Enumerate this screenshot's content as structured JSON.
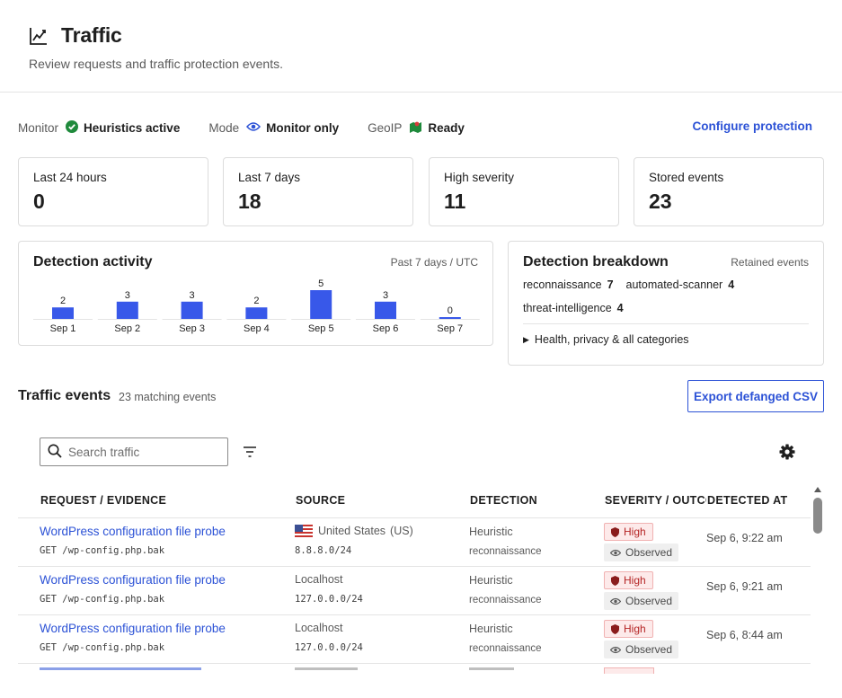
{
  "header": {
    "icon": "chart-line-icon",
    "title": "Traffic",
    "subtitle": "Review requests and traffic protection events."
  },
  "status": {
    "monitor_label": "Monitor",
    "monitor_value": "Heuristics active",
    "mode_label": "Mode",
    "mode_value": "Monitor only",
    "geoip_label": "GeoIP",
    "geoip_value": "Ready",
    "configure_link": "Configure protection"
  },
  "stats": [
    {
      "label": "Last 24 hours",
      "value": "0"
    },
    {
      "label": "Last 7 days",
      "value": "18"
    },
    {
      "label": "High severity",
      "value": "11"
    },
    {
      "label": "Stored events",
      "value": "23"
    }
  ],
  "activity": {
    "title": "Detection activity",
    "meta": "Past 7 days / UTC"
  },
  "chart_data": {
    "type": "bar",
    "categories": [
      "Sep 1",
      "Sep 2",
      "Sep 3",
      "Sep 4",
      "Sep 5",
      "Sep 6",
      "Sep 7"
    ],
    "values": [
      2,
      3,
      3,
      2,
      5,
      3,
      0
    ],
    "title": "Detection activity",
    "subtitle": "Past 7 days / UTC",
    "bar_color": "#3858e9",
    "grid": false
  },
  "breakdown": {
    "title": "Detection breakdown",
    "meta": "Retained events",
    "items": [
      {
        "label": "reconnaissance",
        "count": "7"
      },
      {
        "label": "automated-scanner",
        "count": "4"
      },
      {
        "label": "threat-intelligence",
        "count": "4"
      }
    ],
    "more_label": "Health, privacy & all categories"
  },
  "events": {
    "title": "Traffic events",
    "count_label": "23 matching events",
    "export_label": "Export defanged CSV",
    "search_placeholder": "Search traffic",
    "columns": [
      "REQUEST / EVIDENCE",
      "SOURCE",
      "DETECTION",
      "SEVERITY / OUTCOME",
      "DETECTED AT"
    ],
    "rows": [
      {
        "title": "WordPress configuration file probe",
        "path": "GET /wp-config.php.bak",
        "source": "United States",
        "source_code": "(US)",
        "ip": "8.8.8.0/24",
        "detection": "Heuristic",
        "category": "reconnaissance",
        "severity": "High",
        "outcome": "Observed",
        "detected_at": "Sep 6, 9:22 am"
      },
      {
        "title": "WordPress configuration file probe",
        "path": "GET /wp-config.php.bak",
        "source": "Localhost",
        "source_code": "",
        "ip": "127.0.0.0/24",
        "detection": "Heuristic",
        "category": "reconnaissance",
        "severity": "High",
        "outcome": "Observed",
        "detected_at": "Sep 6, 9:21 am"
      },
      {
        "title": "WordPress configuration file probe",
        "path": "GET /wp-config.php.bak",
        "source": "Localhost",
        "source_code": "",
        "ip": "127.0.0.0/24",
        "detection": "Heuristic",
        "category": "reconnaissance",
        "severity": "High",
        "outcome": "Observed",
        "detected_at": "Sep 6, 8:44 am"
      }
    ]
  },
  "colors": {
    "accent": "#2c52d6",
    "success": "#1f8a3c",
    "danger": "#b52626"
  }
}
